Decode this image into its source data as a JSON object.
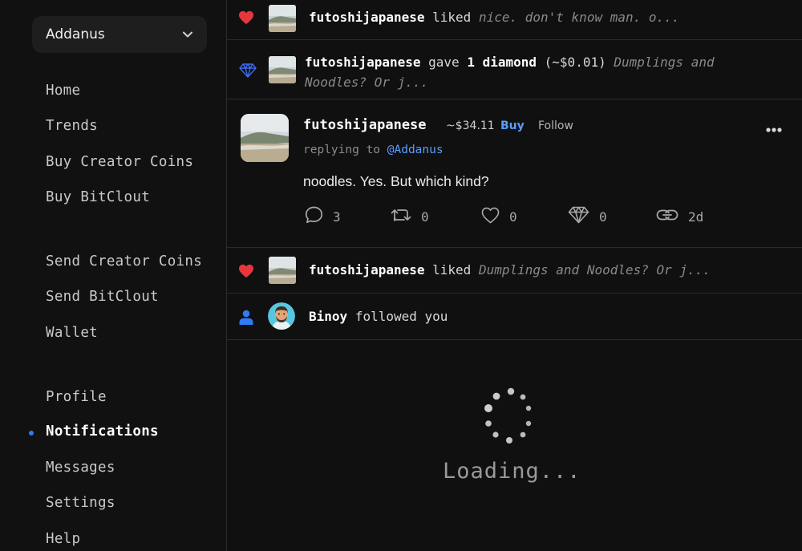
{
  "account": {
    "name": "Addanus"
  },
  "nav": {
    "home": "Home",
    "trends": "Trends",
    "buy_creator_coins": "Buy Creator Coins",
    "buy_bitclout": "Buy BitClout",
    "send_creator_coins": "Send Creator Coins",
    "send_bitclout": "Send BitClout",
    "wallet": "Wallet",
    "profile": "Profile",
    "notifications": "Notifications",
    "messages": "Messages",
    "settings": "Settings",
    "help": "Help",
    "active": "notifications"
  },
  "notifications": [
    {
      "type": "like",
      "icon": "heart-icon",
      "user": "futoshijapanese",
      "action": "liked",
      "snippet": "nice. don't know man. o..."
    },
    {
      "type": "diamond",
      "icon": "diamond-icon",
      "user": "futoshijapanese",
      "action_pre": "gave",
      "amount": "1 diamond",
      "value": "(~$0.01)",
      "snippet_line1": "Dumplings and",
      "snippet_line2": "Noodles? Or j..."
    },
    {
      "type": "like",
      "icon": "heart-icon",
      "user": "futoshijapanese",
      "action": "liked",
      "snippet": "Dumplings and Noodles? Or j..."
    },
    {
      "type": "follow",
      "icon": "person-icon",
      "user": "Binoy",
      "action": "followed you"
    }
  ],
  "post": {
    "user": "futoshijapanese",
    "coin_price": "~$34.11",
    "buy_label": "Buy",
    "follow_label": "Follow",
    "replying_prefix": "replying to",
    "replying_to": "@Addanus",
    "body": "noodles. Yes. But which kind?",
    "comments": "3",
    "reclouts": "0",
    "likes": "0",
    "diamonds": "0",
    "age": "2d"
  },
  "loading_text": "Loading...",
  "colors": {
    "accent": "#5b9cff",
    "heart": "#e8363f",
    "diamond": "#3b6cf0",
    "person": "#2f7cf6",
    "background": "#101010"
  }
}
